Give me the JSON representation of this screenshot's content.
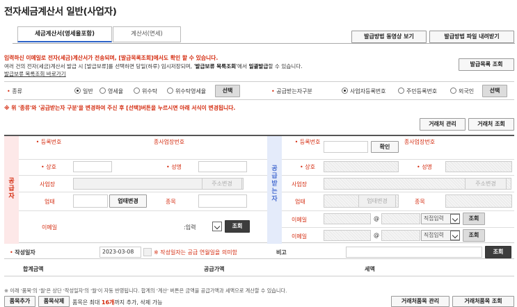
{
  "page_title": "전자세금계산서 일반(사업자)",
  "tabs": [
    {
      "label": "세금계산서(영세율포함)"
    },
    {
      "label": "계산서(면세)"
    }
  ],
  "top_buttons": {
    "video": "발급방법 동영상 보기",
    "download": "발급방법 파일 내려받기",
    "issue_list": "발급목록 조회"
  },
  "notices": {
    "line1": "입력하신 이메일로 전자(세금)계산서가 전송되며, [발급목록조회]에서도 확인 할 수 있습니다.",
    "line2_a": "여러 건의 전자(세금)계산서 발급 시 [발급보류]를 선택하면 당일(하루) 임시저장되며, '",
    "line2_b": "발급보류 목록조회",
    "line2_c": "'에서 ",
    "line2_d": "일괄발급",
    "line2_e": "할 수 있습니다.",
    "line3": "발급보류 목록조회 바로가기",
    "red_note": "※ 위 '종류'와 '공급받는자 구분'을 변경하여 주신 후 [선택]버튼을 누르시면 아래 서식이 변경됩니다."
  },
  "type_row": {
    "label": "종류",
    "options": [
      "일반",
      "영세율",
      "위수탁",
      "위수탁영세율"
    ],
    "select_btn": "선택",
    "recv_label": "공급받는자구분",
    "recv_options": [
      "사업자등록번호",
      "주민등록번호",
      "외국인"
    ],
    "recv_select_btn": "선택"
  },
  "partner_buttons": {
    "manage": "거래처 관리",
    "lookup": "거래처 조회"
  },
  "supplier": {
    "side": "공급자",
    "reg_no": "등록번호",
    "sub_no": "종사업장번호",
    "name": "상호",
    "rep": "성명",
    "address": "사업장",
    "address_btn": "주소변경",
    "biz_type": "업태",
    "biz_btn": "업태변경",
    "item": "종목",
    "email": "이메일",
    "email_select": "입력",
    "email_btn": "조회"
  },
  "receiver": {
    "side": "공급받는자",
    "reg_no": "등록번호",
    "confirm_btn": "확인",
    "sub_no": "종사업장번호",
    "name": "상호",
    "rep": "성명",
    "address": "사업장",
    "address_btn": "주소변경",
    "biz_type": "업태",
    "biz_btn": "업태변경",
    "item": "종목",
    "email1": "이메일",
    "email2": "이메일",
    "at": "@",
    "direct": "직접입력",
    "lookup_btn": "조회"
  },
  "date_row": {
    "label": "작성일자",
    "value": "2023-03-08",
    "note": "※ 작성일자는 공급 연월일을 의미함",
    "memo": "비고",
    "memo_btn": "조회"
  },
  "sum_row": {
    "total": "합계금액",
    "supply": "공급가액",
    "tax": "세액"
  },
  "bottom": {
    "note": "※ 이래 '품목'의 '월'은 상단 '작성일자'의 '월'이 자동 반영됩니다. 합계의 '계산' 버튼은 금액을 공급가액과 세액으로 계산할 수 있습니다.",
    "add": "품목추가",
    "del": "품목삭제",
    "limit_a": "품목은 최대",
    "limit_num": "16개",
    "limit_b": "까지 추가, 삭제 가능",
    "item_manage": "거래처품목 관리",
    "item_lookup": "거래처품목 조회"
  }
}
